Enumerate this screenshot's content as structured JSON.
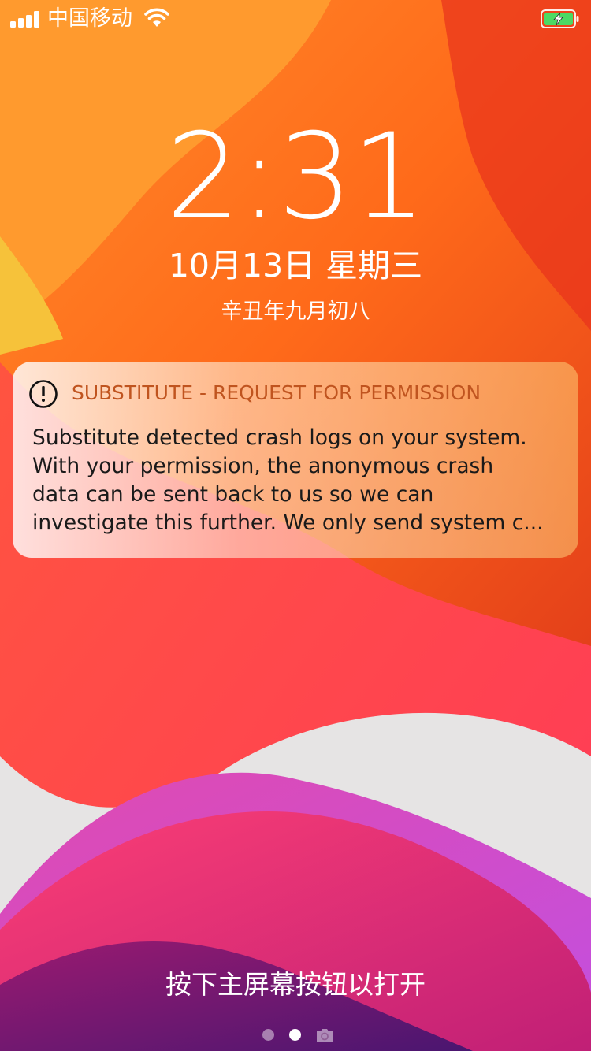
{
  "status_bar": {
    "carrier": "中国移动",
    "signal_bars": 4,
    "wifi_icon": "wifi-icon",
    "battery_icon": "battery-charging-icon",
    "battery_color": "#4cd964"
  },
  "lock_screen": {
    "time": "2:31",
    "date": "10月13日 星期三",
    "lunar_date": "辛丑年九月初八"
  },
  "notification": {
    "icon": "alert-circle-icon",
    "app_title": "SUBSTITUTE - REQUEST FOR PERMISSION",
    "body_lines": [
      "Substitute detected crash logs on your system.",
      "With your permission, the anonymous crash",
      "data can be sent back to us so we can",
      "investigate this further. We only send system c..."
    ],
    "title_color": "#c0541f"
  },
  "bottom": {
    "unlock_hint": "按下主屏幕按钮以打开",
    "page_indicator": {
      "pages": 2,
      "current": 2,
      "camera_icon": "camera-icon"
    }
  }
}
